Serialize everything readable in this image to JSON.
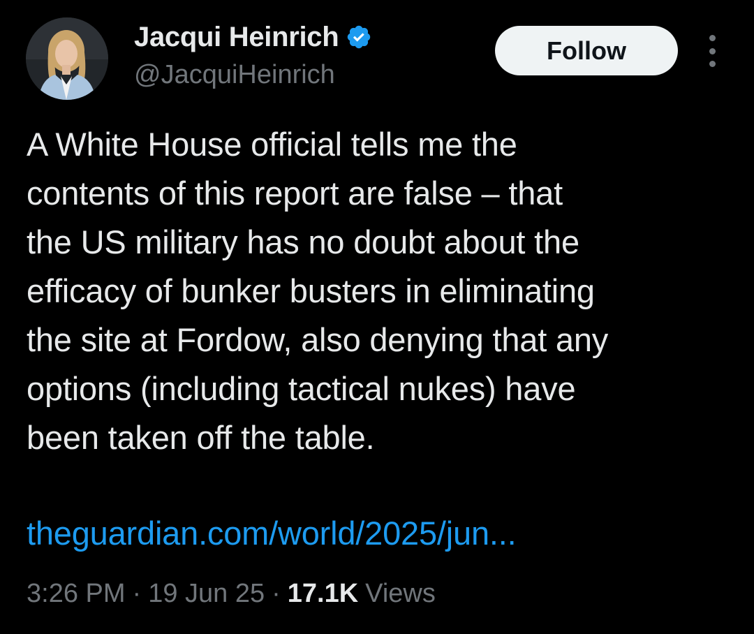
{
  "author": {
    "display_name": "Jacqui Heinrich",
    "handle": "@JacquiHeinrich",
    "verified": true,
    "avatar_icon": "profile-photo"
  },
  "actions": {
    "follow_label": "Follow",
    "more_icon": "more-vertical-icon"
  },
  "tweet": {
    "text": "A White House official tells me the\ncontents of this report are false – that\nthe US military has no doubt about the\nefficacy of bunker busters in eliminating\nthe site at Fordow, also denying that any\noptions (including tactical nukes) have\nbeen taken off the table.",
    "link": "theguardian.com/world/2025/jun..."
  },
  "meta": {
    "time": "3:26 PM",
    "separator": "·",
    "date": "19 Jun 25",
    "views_count": "17.1K",
    "views_label": "Views"
  },
  "colors": {
    "background": "#000000",
    "text": "#e7e9ea",
    "secondary": "#71767b",
    "link": "#1d9bf0",
    "verified_badge": "#1d9bf0",
    "follow_button_bg": "#eff3f4"
  }
}
